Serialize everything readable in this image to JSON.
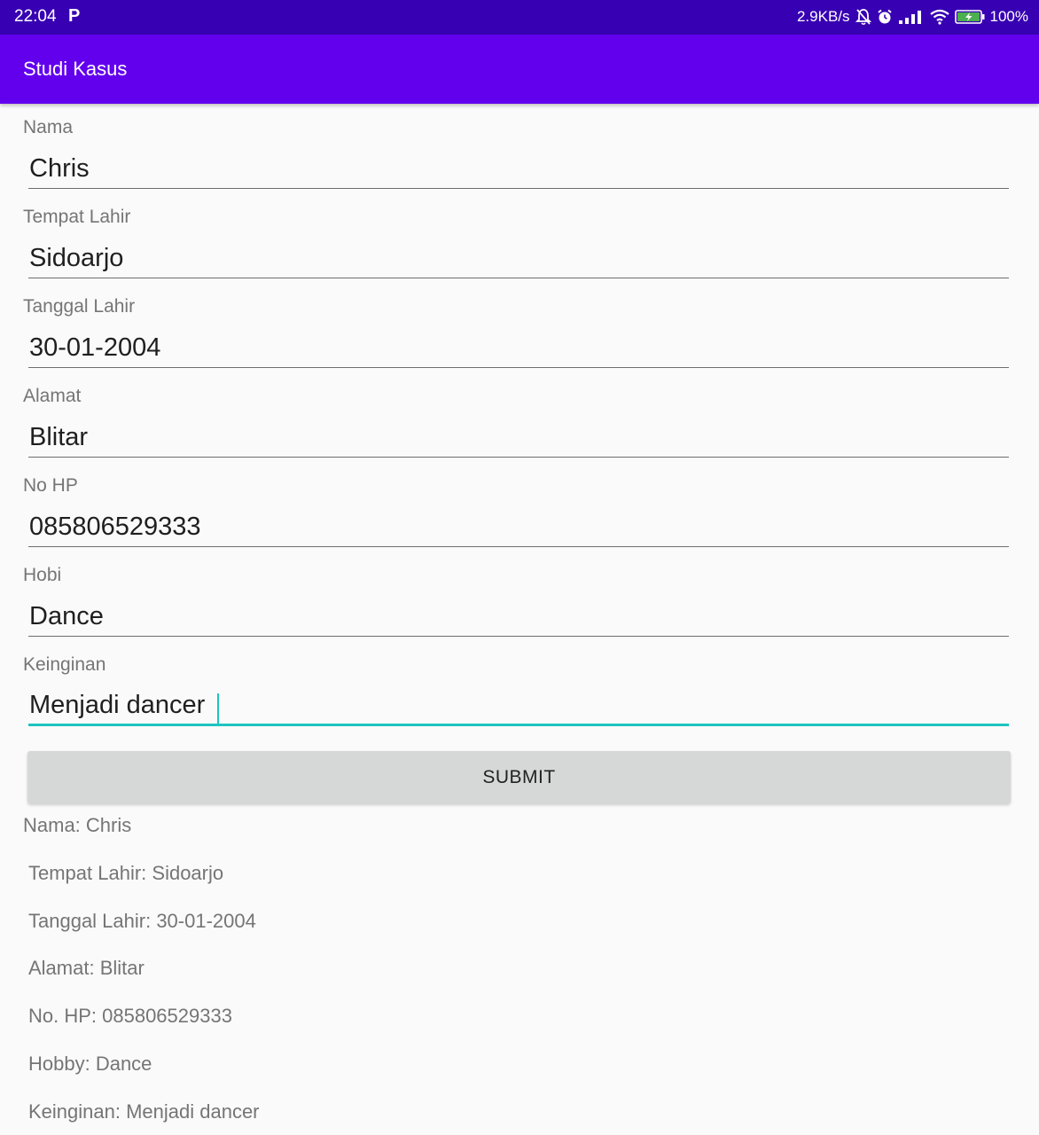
{
  "status_bar": {
    "time": "22:04",
    "notification_app_icon": "p-icon",
    "net_speed": "2.9KB/s",
    "battery_percent": "100%",
    "icons": [
      "bell-off-icon",
      "alarm-icon",
      "signal-icon",
      "wifi-icon",
      "battery-charging-icon"
    ]
  },
  "app_bar": {
    "title": "Studi Kasus"
  },
  "form": {
    "fields": [
      {
        "label": "Nama",
        "value": "Chris"
      },
      {
        "label": "Tempat Lahir",
        "value": "Sidoarjo"
      },
      {
        "label": "Tanggal Lahir",
        "value": "30-01-2004"
      },
      {
        "label": "Alamat",
        "value": "Blitar"
      },
      {
        "label": "No HP",
        "value": "085806529333"
      },
      {
        "label": "Hobi",
        "value": "Dance"
      },
      {
        "label": "Keinginan",
        "value": "Menjadi dancer"
      }
    ],
    "submit_label": "SUBMIT"
  },
  "results": [
    "Nama: Chris",
    "Tempat Lahir: Sidoarjo",
    "Tanggal Lahir: 30-01-2004",
    "Alamat: Blitar",
    "No. HP: 085806529333",
    "Hobby: Dance",
    "Keinginan: Menjadi dancer"
  ],
  "colors": {
    "status_bar": "#3700b3",
    "app_bar": "#6200ee",
    "accent": "#1dc4c0",
    "background": "#fafafa",
    "button": "#d6d7d7"
  }
}
